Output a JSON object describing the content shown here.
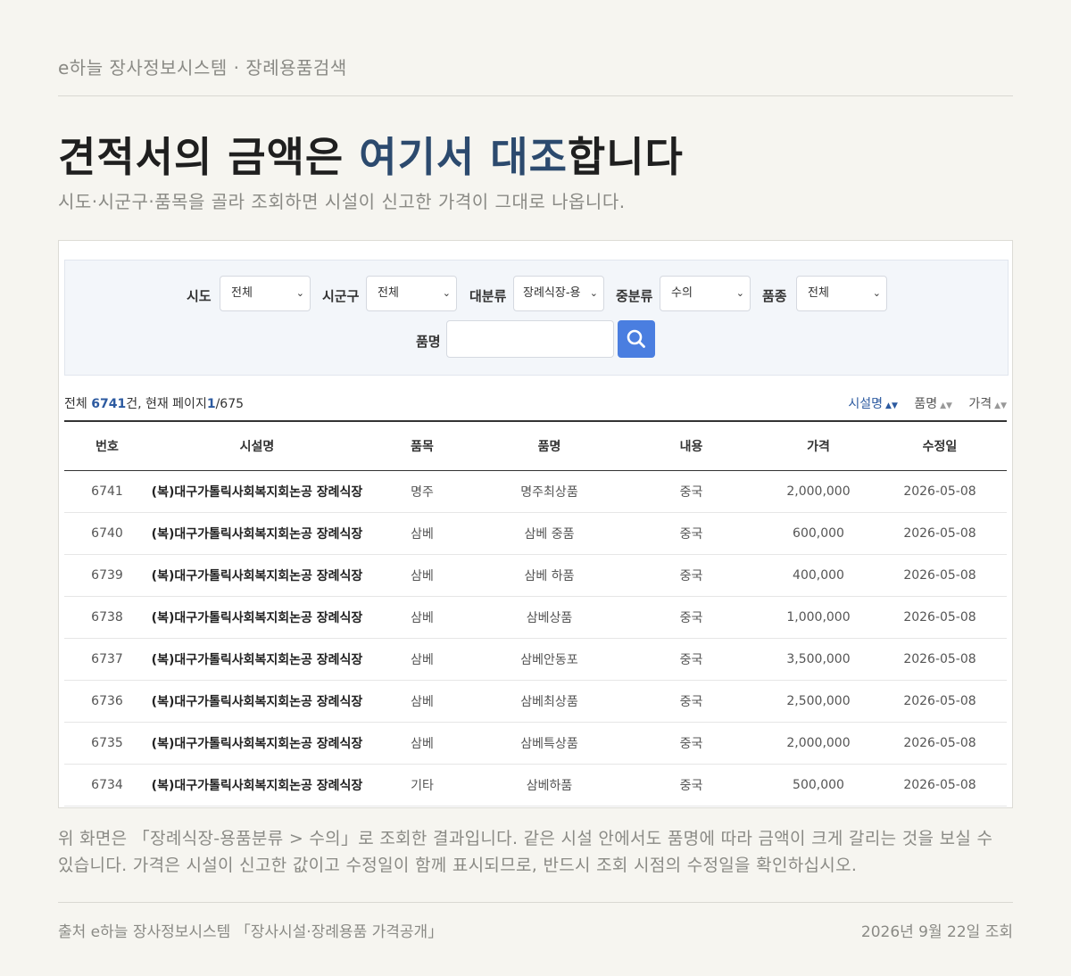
{
  "header": {
    "breadcrumb": "e하늘 장사정보시스템 · 장례용품검색",
    "headline_pre": "견적서의 금액은 ",
    "headline_accent": "여기서 대조",
    "headline_post": "합니다",
    "subheadline": "시도·시군구·품목을 골라 조회하면 시설이 신고한 가격이 그대로 나옵니다."
  },
  "filters": {
    "sido": {
      "label": "시도",
      "value": "전체"
    },
    "sigungu": {
      "label": "시군구",
      "value": "전체"
    },
    "major": {
      "label": "대분류",
      "value": "장례식장-용"
    },
    "middle": {
      "label": "중분류",
      "value": "수의"
    },
    "kind": {
      "label": "품종",
      "value": "전체"
    },
    "name": {
      "label": "품명",
      "value": ""
    }
  },
  "summary": {
    "total_prefix": "전체 ",
    "total": "6741",
    "total_suffix": "건, 현재 페이지",
    "page": "1",
    "pages": "/675"
  },
  "sort": {
    "facility": "시설명",
    "item": "품명",
    "price": "가격",
    "active": "facility"
  },
  "table": {
    "headers": [
      "번호",
      "시설명",
      "품목",
      "품명",
      "내용",
      "가격",
      "수정일"
    ],
    "rows": [
      [
        "6741",
        "(복)대구가톨릭사회복지회논공 장례식장",
        "명주",
        "명주최상품",
        "중국",
        "2,000,000",
        "2026-05-08"
      ],
      [
        "6740",
        "(복)대구가톨릭사회복지회논공 장례식장",
        "삼베",
        "삼베 중품",
        "중국",
        "600,000",
        "2026-05-08"
      ],
      [
        "6739",
        "(복)대구가톨릭사회복지회논공 장례식장",
        "삼베",
        "삼베 하품",
        "중국",
        "400,000",
        "2026-05-08"
      ],
      [
        "6738",
        "(복)대구가톨릭사회복지회논공 장례식장",
        "삼베",
        "삼베상품",
        "중국",
        "1,000,000",
        "2026-05-08"
      ],
      [
        "6737",
        "(복)대구가톨릭사회복지회논공 장례식장",
        "삼베",
        "삼베안동포",
        "중국",
        "3,500,000",
        "2026-05-08"
      ],
      [
        "6736",
        "(복)대구가톨릭사회복지회논공 장례식장",
        "삼베",
        "삼베최상품",
        "중국",
        "2,500,000",
        "2026-05-08"
      ],
      [
        "6735",
        "(복)대구가톨릭사회복지회논공 장례식장",
        "삼베",
        "삼베특상품",
        "중국",
        "2,000,000",
        "2026-05-08"
      ],
      [
        "6734",
        "(복)대구가톨릭사회복지회논공 장례식장",
        "기타",
        "삼베하품",
        "중국",
        "500,000",
        "2026-05-08"
      ]
    ]
  },
  "caption": "위 화면은 「장례식장-용품분류 > 수의」로 조회한 결과입니다. 같은 시설 안에서도 품명에 따라 금액이 크게 갈리는 것을 보실 수 있습니다. 가격은 시설이 신고한 값이고 수정일이 함께 표시되므로, 반드시 조회 시점의 수정일을 확인하십시오.",
  "footer": {
    "source": "출처 e하늘 장사정보시스템 「장사시설·장례용품 가격공개」",
    "date": "2026년 9월 22일 조회"
  },
  "icons": {
    "search": "search-icon",
    "chevron": "chevron-down-icon",
    "sort": "sort-icon"
  },
  "colors": {
    "accent": "#2c4a6e",
    "button": "#4a7ee0",
    "link": "#2c5aa0",
    "background": "#f6f5f0"
  }
}
